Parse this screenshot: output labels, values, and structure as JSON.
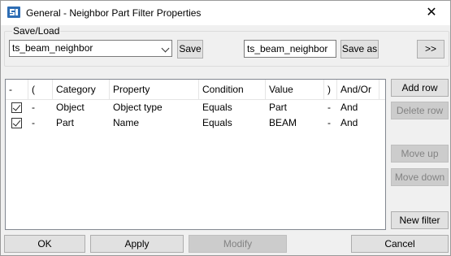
{
  "window": {
    "title": "General - Neighbor Part Filter Properties",
    "close_glyph": "✕"
  },
  "save_load": {
    "group_label": "Save/Load",
    "selected_value": "ts_beam_neighbor",
    "save_label": "Save",
    "save_as_value": "ts_beam_neighbor",
    "save_as_label": "Save as",
    "more_label": ">>"
  },
  "table": {
    "headers": [
      "-",
      "(",
      "Category",
      "Property",
      "Condition",
      "Value",
      ")",
      "And/Or"
    ],
    "rows": [
      {
        "checked": true,
        "dash": "-",
        "category": "Object",
        "property": "Object type",
        "condition": "Equals",
        "value": "Part",
        "close": "-",
        "andor": "And"
      },
      {
        "checked": true,
        "dash": "-",
        "category": "Part",
        "property": "Name",
        "condition": "Equals",
        "value": "BEAM",
        "close": "-",
        "andor": "And"
      }
    ]
  },
  "side_buttons": {
    "add_row": "Add row",
    "delete_row": "Delete row",
    "move_up": "Move up",
    "move_down": "Move down",
    "new_filter": "New filter"
  },
  "bottom_buttons": {
    "ok": "OK",
    "apply": "Apply",
    "modify": "Modify",
    "cancel": "Cancel"
  },
  "icons": {
    "app": "filter-app-icon",
    "close": "close-icon",
    "chevron": "chevron-down-icon",
    "checkbox": "checkbox-checked-icon"
  },
  "colors": {
    "titlebar": "#ffffff",
    "window_bg": "#f0f0f0",
    "app_icon": "#2e6db4",
    "disabled_text": "#838383"
  }
}
